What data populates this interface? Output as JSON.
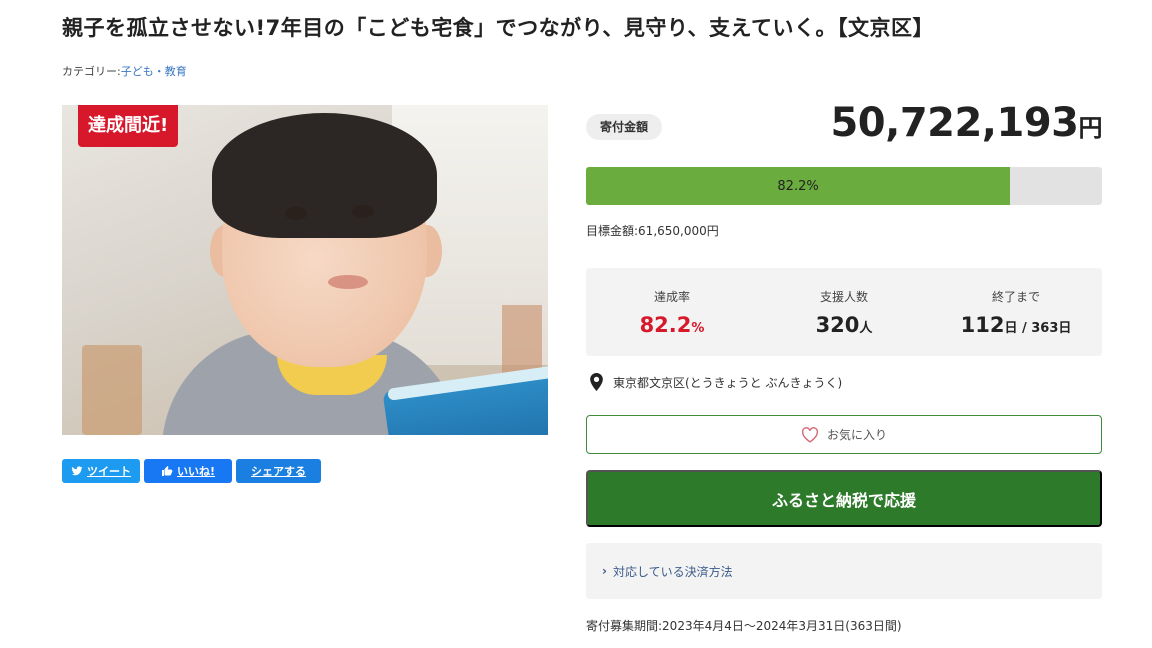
{
  "page": {
    "title": "親子を孤立させない!7年目の「こども宅食」でつながり、見守り、支えていく。【文京区】",
    "category_label": "カテゴリー:",
    "category_value": "子ども・教育"
  },
  "hero": {
    "badge": "達成間近!"
  },
  "share": {
    "twitter": "ツイート",
    "facebook": "いいね!",
    "line": "シェアする"
  },
  "donation": {
    "label": "寄付金額",
    "amount": "50,722,193",
    "currency": "円",
    "progress_percent": 82.2,
    "progress_text": "82.2%",
    "goal": "目標金額:61,650,000円"
  },
  "stats": {
    "rate_label": "達成率",
    "rate_value": "82.2",
    "rate_unit": "%",
    "supporters_label": "支援人数",
    "supporters_value": "320",
    "supporters_unit": "人",
    "remaining_label": "終了まで",
    "remaining_value": "112",
    "remaining_unit": "日 / 363日"
  },
  "location": "東京都文京区(とうきょうと ぶんきょうく)",
  "favorite": "お気に入り",
  "cta": "ふるさと納税で応援",
  "payment": "対応している決済方法",
  "period": "寄付募集期間:2023年4月4日〜2024年3月31日(363日間)",
  "colors": {
    "accent_green": "#2d7a2a",
    "progress_green": "#6aad3e",
    "badge_red": "#d7182a",
    "twitter_blue": "#1d9bf0",
    "facebook_blue": "#1877f2"
  },
  "icons": {
    "location": "map-pin-icon",
    "favorite": "heart-icon",
    "twitter": "twitter-bird-icon",
    "facebook": "thumbs-up-icon",
    "payment": "chevron-right-icon"
  }
}
